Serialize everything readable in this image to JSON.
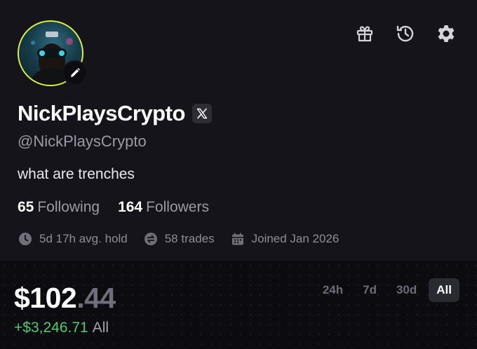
{
  "profile": {
    "display_name": "NickPlaysCrypto",
    "handle": "@NickPlaysCrypto",
    "bio": "what are trenches",
    "following_count": "65",
    "following_label": "Following",
    "followers_count": "164",
    "followers_label": "Followers",
    "linked_account_icon": "x-logo-icon",
    "avatar_ring_color": "#d9f23a"
  },
  "header_icons": [
    "gift-icon",
    "history-icon",
    "gear-icon"
  ],
  "stats": {
    "avg_hold": "5d 17h avg. hold",
    "trades": "58 trades",
    "joined": "Joined Jan 2026"
  },
  "portfolio": {
    "value_main": "$102",
    "value_decimal": ".44",
    "pnl": "+$3,246.71",
    "pnl_period": "All",
    "pnl_color": "#4ecb71",
    "ranges": [
      "24h",
      "7d",
      "30d",
      "All"
    ],
    "selected_range": "All"
  }
}
